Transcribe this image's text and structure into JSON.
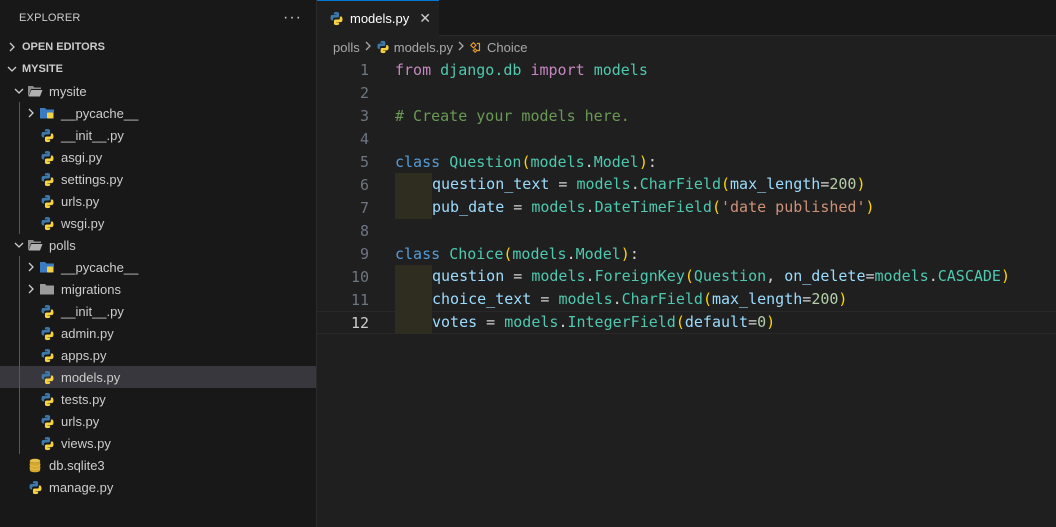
{
  "sidebar": {
    "title": "EXPLORER",
    "more_label": "···",
    "open_editors": "OPEN EDITORS",
    "workspace": "MYSITE",
    "tree": [
      {
        "label": "mysite",
        "depth": 1,
        "type": "folder-open",
        "chev": "down"
      },
      {
        "label": "__pycache__",
        "depth": 2,
        "type": "folder-py",
        "chev": "right"
      },
      {
        "label": "__init__.py",
        "depth": 2,
        "type": "py"
      },
      {
        "label": "asgi.py",
        "depth": 2,
        "type": "py"
      },
      {
        "label": "settings.py",
        "depth": 2,
        "type": "py"
      },
      {
        "label": "urls.py",
        "depth": 2,
        "type": "py"
      },
      {
        "label": "wsgi.py",
        "depth": 2,
        "type": "py"
      },
      {
        "label": "polls",
        "depth": 1,
        "type": "folder-open",
        "chev": "down"
      },
      {
        "label": "__pycache__",
        "depth": 2,
        "type": "folder-py",
        "chev": "right"
      },
      {
        "label": "migrations",
        "depth": 2,
        "type": "folder",
        "chev": "right"
      },
      {
        "label": "__init__.py",
        "depth": 2,
        "type": "py"
      },
      {
        "label": "admin.py",
        "depth": 2,
        "type": "py"
      },
      {
        "label": "apps.py",
        "depth": 2,
        "type": "py"
      },
      {
        "label": "models.py",
        "depth": 2,
        "type": "py",
        "selected": true
      },
      {
        "label": "tests.py",
        "depth": 2,
        "type": "py"
      },
      {
        "label": "urls.py",
        "depth": 2,
        "type": "py"
      },
      {
        "label": "views.py",
        "depth": 2,
        "type": "py"
      },
      {
        "label": "db.sqlite3",
        "depth": 1,
        "type": "db"
      },
      {
        "label": "manage.py",
        "depth": 1,
        "type": "py"
      }
    ]
  },
  "tab": {
    "label": "models.py",
    "close": "✕"
  },
  "breadcrumbs": {
    "folder": "polls",
    "file": "models.py",
    "symbol": "Choice"
  },
  "code": {
    "current_line": 12,
    "lines": [
      {
        "n": "1",
        "indent": false,
        "tokens": [
          [
            "kw2",
            "from"
          ],
          [
            "op",
            " "
          ],
          [
            "cls",
            "django.db"
          ],
          [
            "op",
            " "
          ],
          [
            "kw2",
            "import"
          ],
          [
            "op",
            " "
          ],
          [
            "cls",
            "models"
          ]
        ]
      },
      {
        "n": "2",
        "indent": false,
        "tokens": []
      },
      {
        "n": "3",
        "indent": false,
        "tokens": [
          [
            "cmt",
            "# Create your models here."
          ]
        ]
      },
      {
        "n": "4",
        "indent": false,
        "tokens": []
      },
      {
        "n": "5",
        "indent": false,
        "tokens": [
          [
            "kw",
            "class"
          ],
          [
            "op",
            " "
          ],
          [
            "cls",
            "Question"
          ],
          [
            "br1",
            "("
          ],
          [
            "cls",
            "models"
          ],
          [
            "op",
            "."
          ],
          [
            "cls",
            "Model"
          ],
          [
            "br1",
            ")"
          ],
          [
            "op",
            ":"
          ]
        ]
      },
      {
        "n": "6",
        "indent": true,
        "tokens": [
          [
            "var",
            "question_text"
          ],
          [
            "op",
            " = "
          ],
          [
            "cls",
            "models"
          ],
          [
            "op",
            "."
          ],
          [
            "cls",
            "CharField"
          ],
          [
            "br1",
            "("
          ],
          [
            "var",
            "max_length"
          ],
          [
            "op",
            "="
          ],
          [
            "num",
            "200"
          ],
          [
            "br1",
            ")"
          ]
        ]
      },
      {
        "n": "7",
        "indent": true,
        "tokens": [
          [
            "var",
            "pub_date"
          ],
          [
            "op",
            " = "
          ],
          [
            "cls",
            "models"
          ],
          [
            "op",
            "."
          ],
          [
            "cls",
            "DateTimeField"
          ],
          [
            "br1",
            "("
          ],
          [
            "str",
            "'date published'"
          ],
          [
            "br1",
            ")"
          ]
        ]
      },
      {
        "n": "8",
        "indent": false,
        "tokens": []
      },
      {
        "n": "9",
        "indent": false,
        "tokens": [
          [
            "kw",
            "class"
          ],
          [
            "op",
            " "
          ],
          [
            "cls",
            "Choice"
          ],
          [
            "br1",
            "("
          ],
          [
            "cls",
            "models"
          ],
          [
            "op",
            "."
          ],
          [
            "cls",
            "Model"
          ],
          [
            "br1",
            ")"
          ],
          [
            "op",
            ":"
          ]
        ]
      },
      {
        "n": "10",
        "indent": true,
        "tokens": [
          [
            "var",
            "question"
          ],
          [
            "op",
            " = "
          ],
          [
            "cls",
            "models"
          ],
          [
            "op",
            "."
          ],
          [
            "cls",
            "ForeignKey"
          ],
          [
            "br1",
            "("
          ],
          [
            "cls",
            "Question"
          ],
          [
            "op",
            ", "
          ],
          [
            "var",
            "on_delete"
          ],
          [
            "op",
            "="
          ],
          [
            "cls",
            "models"
          ],
          [
            "op",
            "."
          ],
          [
            "cls",
            "CASCADE"
          ],
          [
            "br1",
            ")"
          ]
        ]
      },
      {
        "n": "11",
        "indent": true,
        "tokens": [
          [
            "var",
            "choice_text"
          ],
          [
            "op",
            " = "
          ],
          [
            "cls",
            "models"
          ],
          [
            "op",
            "."
          ],
          [
            "cls",
            "CharField"
          ],
          [
            "br1",
            "("
          ],
          [
            "var",
            "max_length"
          ],
          [
            "op",
            "="
          ],
          [
            "num",
            "200"
          ],
          [
            "br1",
            ")"
          ]
        ]
      },
      {
        "n": "12",
        "indent": true,
        "tokens": [
          [
            "var",
            "votes"
          ],
          [
            "op",
            " = "
          ],
          [
            "cls",
            "models"
          ],
          [
            "op",
            "."
          ],
          [
            "cls",
            "IntegerField"
          ],
          [
            "br1",
            "("
          ],
          [
            "var",
            "default"
          ],
          [
            "op",
            "="
          ],
          [
            "num",
            "0"
          ],
          [
            "br1",
            ")"
          ]
        ]
      }
    ]
  }
}
